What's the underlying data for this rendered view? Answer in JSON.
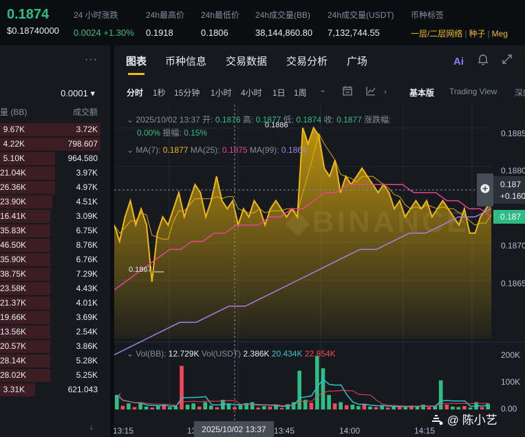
{
  "ticker": {
    "last_price": "0.1874",
    "last_price_usd": "$0.18740000",
    "stats": [
      {
        "label": "24 小时涨跌",
        "value": "0.0024 +1.30%"
      },
      {
        "label": "24h最高价",
        "value": "0.1918"
      },
      {
        "label": "24h最低价",
        "value": "0.1806"
      },
      {
        "label": "24h成交量(BB)",
        "value": "38,144,860.80"
      },
      {
        "label": "24h成交量(USDT)",
        "value": "7,132,744.55"
      }
    ],
    "tag_label": "币种标签",
    "tags": [
      "一层/二层网络",
      "种子",
      "Meg"
    ]
  },
  "orderbook": {
    "more_icon": "more-dots-icon",
    "tick_size": "0.0001 ▾",
    "col_amount": "量 (BB)",
    "col_total": "成交额",
    "rows": [
      {
        "amount": "9.67K",
        "total": "3.72K",
        "depth": 1.0
      },
      {
        "amount": "4.22K",
        "total": "798.607",
        "depth": 1.0
      },
      {
        "amount": "5.10K",
        "total": "964.580",
        "depth": 0.55
      },
      {
        "amount": "21.04K",
        "total": "3.97K",
        "depth": 0.55
      },
      {
        "amount": "26.36K",
        "total": "4.97K",
        "depth": 0.55
      },
      {
        "amount": "23.90K",
        "total": "4.51K",
        "depth": 0.52
      },
      {
        "amount": "16.41K",
        "total": "3.09K",
        "depth": 0.5
      },
      {
        "amount": "35.83K",
        "total": "6.75K",
        "depth": 0.5
      },
      {
        "amount": "46.50K",
        "total": "8.76K",
        "depth": 0.5
      },
      {
        "amount": "35.90K",
        "total": "6.76K",
        "depth": 0.5
      },
      {
        "amount": "38.75K",
        "total": "7.29K",
        "depth": 0.5
      },
      {
        "amount": "23.58K",
        "total": "4.43K",
        "depth": 0.5
      },
      {
        "amount": "21.37K",
        "total": "4.01K",
        "depth": 0.5
      },
      {
        "amount": "19.66K",
        "total": "3.69K",
        "depth": 0.5
      },
      {
        "amount": "13.56K",
        "total": "2.54K",
        "depth": 0.5
      },
      {
        "amount": "20.57K",
        "total": "3.86K",
        "depth": 0.5
      },
      {
        "amount": "28.14K",
        "total": "5.28K",
        "depth": 0.5
      },
      {
        "amount": "28.02K",
        "total": "5.25K",
        "depth": 0.5
      },
      {
        "amount": "3.31K",
        "total": "621.043",
        "depth": 0.35
      }
    ],
    "footer_icon": "arrow-down-icon"
  },
  "chart_tabs": [
    "图表",
    "币种信息",
    "交易数据",
    "交易分析",
    "广场"
  ],
  "chart_tab_icons": [
    "ai-icon",
    "bell-icon",
    "expand-icon"
  ],
  "ai_label": "Ai",
  "toolbar": {
    "intervals": [
      "分时",
      "1秒",
      "15分钟",
      "1小时",
      "4小时",
      "1日",
      "1周"
    ],
    "icons": [
      "chevron-down-icon",
      "calendar-icon",
      "indicator-icon",
      "chevron-right-icon"
    ],
    "views": [
      "基本版",
      "Trading View",
      "深度"
    ]
  },
  "ohlc": {
    "datetime": "2025/10/02 13:37",
    "open_label": "开:",
    "open": "0.1876",
    "high_label": "高:",
    "high": "0.1877",
    "low_label": "低:",
    "low": "0.1874",
    "close_label": "收:",
    "close": "0.1877",
    "change_label": "涨跌幅:",
    "change": "0.00%",
    "amp_label": "振幅:",
    "amp": "0.15%"
  },
  "ma": {
    "ma7_label": "MA(7):",
    "ma7": "0.1877",
    "ma25_label": "MA(25):",
    "ma25": "0.1875",
    "ma99_label": "MA(99):",
    "ma99": "0.1864"
  },
  "vol": {
    "bb_label": "Vol(BB):",
    "bb": "12.729K",
    "usdt_label": "Vol(USDT)",
    "usdt": "2.386K",
    "ma1": "20.434K",
    "ma2": "22.854K"
  },
  "price_axis": [
    "0.1885",
    "0.1880",
    "0.1870",
    "0.1865"
  ],
  "vol_axis": [
    "200K",
    "100K",
    "0.00"
  ],
  "price_tag_top": "0.187",
  "price_tag_mid": "+0.160",
  "price_tag_last": "0.187",
  "low_marker": "0.1867",
  "high_marker": "0.1886",
  "x_axis": [
    "13:15",
    "13:",
    "13:45",
    "14:00",
    "14:15"
  ],
  "crosshair_time": "2025/10/02 13:37",
  "watermark_text": "@ 陈小艺",
  "colors": {
    "up": "#2ebd85",
    "down": "#f6465d",
    "accent": "#f0b90b",
    "ma25": "#e84393",
    "ma99": "#a580e6",
    "vol_ma": "#2ec1cb"
  },
  "chart_data": {
    "type": "area",
    "price_series": [
      0.1874,
      0.1872,
      0.1875,
      0.1877,
      0.1874,
      0.1876,
      0.1874,
      0.1867,
      0.1873,
      0.1875,
      0.1874,
      0.1876,
      0.1878,
      0.1875,
      0.1877,
      0.1879,
      0.1878,
      0.1875,
      0.1877,
      0.188,
      0.1877,
      0.1876,
      0.1877,
      0.1874,
      0.1876,
      0.1875,
      0.1877,
      0.1876,
      0.1874,
      0.1876,
      0.1877,
      0.1876,
      0.1875,
      0.1876,
      0.1875,
      0.1886,
      0.1884,
      0.1886,
      0.1885,
      0.1881,
      0.188,
      0.1882,
      0.1878,
      0.188,
      0.1879,
      0.188,
      0.1881,
      0.188,
      0.1879,
      0.1878,
      0.1879,
      0.1878,
      0.1876,
      0.1877,
      0.1875,
      0.1876,
      0.1877,
      0.1876,
      0.1877,
      0.1875,
      0.1876,
      0.1877,
      0.1876,
      0.1875,
      0.1874,
      0.1876,
      0.1873,
      0.1873,
      0.1875,
      0.1876,
      0.1877
    ],
    "ma25_series": [
      0.1866,
      0.1867,
      0.1868,
      0.1869,
      0.187,
      0.1871,
      0.1871,
      0.1872,
      0.1872,
      0.1873,
      0.1873,
      0.1874,
      0.1874,
      0.1874,
      0.1875,
      0.1875,
      0.1876,
      0.1876,
      0.1877,
      0.1878,
      0.1878,
      0.1879,
      0.1879,
      0.1879,
      0.1879,
      0.1879,
      0.1879,
      0.1878,
      0.1878,
      0.1878,
      0.1877,
      0.1877,
      0.1876,
      0.1876,
      0.1875
    ],
    "ma99_series": [
      0.1858,
      0.1859,
      0.186,
      0.1861,
      0.1862,
      0.1862,
      0.1863,
      0.1864,
      0.1864,
      0.1865,
      0.1866,
      0.1867,
      0.1868,
      0.1869,
      0.187,
      0.1871,
      0.1871,
      0.1872,
      0.1873,
      0.1873,
      0.1874,
      0.1875,
      0.1875,
      0.1876
    ],
    "volume": [
      {
        "v": 60,
        "up": true
      },
      {
        "v": 15,
        "up": false
      },
      {
        "v": 25,
        "up": true
      },
      {
        "v": 10,
        "up": false
      },
      {
        "v": 30,
        "up": true
      },
      {
        "v": 12,
        "up": true
      },
      {
        "v": 8,
        "up": false
      },
      {
        "v": 18,
        "up": true
      },
      {
        "v": 20,
        "up": false
      },
      {
        "v": 10,
        "up": true
      },
      {
        "v": 14,
        "up": true
      },
      {
        "v": 180,
        "up": false
      },
      {
        "v": 20,
        "up": true
      },
      {
        "v": 25,
        "up": true
      },
      {
        "v": 12,
        "up": false
      },
      {
        "v": 30,
        "up": true
      },
      {
        "v": 16,
        "up": true
      },
      {
        "v": 9,
        "up": false
      },
      {
        "v": 40,
        "up": true
      },
      {
        "v": 22,
        "up": true
      },
      {
        "v": 10,
        "up": false
      },
      {
        "v": 18,
        "up": true
      },
      {
        "v": 26,
        "up": true
      },
      {
        "v": 30,
        "up": true
      },
      {
        "v": 8,
        "up": false
      },
      {
        "v": 14,
        "up": true
      },
      {
        "v": 12,
        "up": false
      },
      {
        "v": 20,
        "up": true
      },
      {
        "v": 6,
        "up": false
      },
      {
        "v": 22,
        "up": true
      },
      {
        "v": 30,
        "up": true
      },
      {
        "v": 160,
        "up": true
      },
      {
        "v": 40,
        "up": true
      },
      {
        "v": 28,
        "up": false
      },
      {
        "v": 220,
        "up": true
      },
      {
        "v": 170,
        "up": true
      },
      {
        "v": 60,
        "up": true
      },
      {
        "v": 25,
        "up": false
      },
      {
        "v": 30,
        "up": true
      },
      {
        "v": 18,
        "up": false
      },
      {
        "v": 20,
        "up": true
      },
      {
        "v": 14,
        "up": true
      },
      {
        "v": 24,
        "up": false
      },
      {
        "v": 12,
        "up": true
      },
      {
        "v": 10,
        "up": false
      },
      {
        "v": 18,
        "up": true
      },
      {
        "v": 8,
        "up": false
      },
      {
        "v": 14,
        "up": true
      },
      {
        "v": 12,
        "up": false
      },
      {
        "v": 10,
        "up": true
      },
      {
        "v": 16,
        "up": false
      },
      {
        "v": 12,
        "up": true
      },
      {
        "v": 20,
        "up": true
      },
      {
        "v": 10,
        "up": false
      },
      {
        "v": 14,
        "up": true
      },
      {
        "v": 120,
        "up": true
      },
      {
        "v": 20,
        "up": false
      },
      {
        "v": 12,
        "up": true
      },
      {
        "v": 10,
        "up": true
      },
      {
        "v": 14,
        "up": false
      },
      {
        "v": 8,
        "up": true
      },
      {
        "v": 30,
        "up": true
      },
      {
        "v": 10,
        "up": false
      },
      {
        "v": 24,
        "up": true
      }
    ],
    "ylim": [
      0.186,
      0.1888
    ],
    "vol_ylim": [
      0,
      250
    ]
  }
}
